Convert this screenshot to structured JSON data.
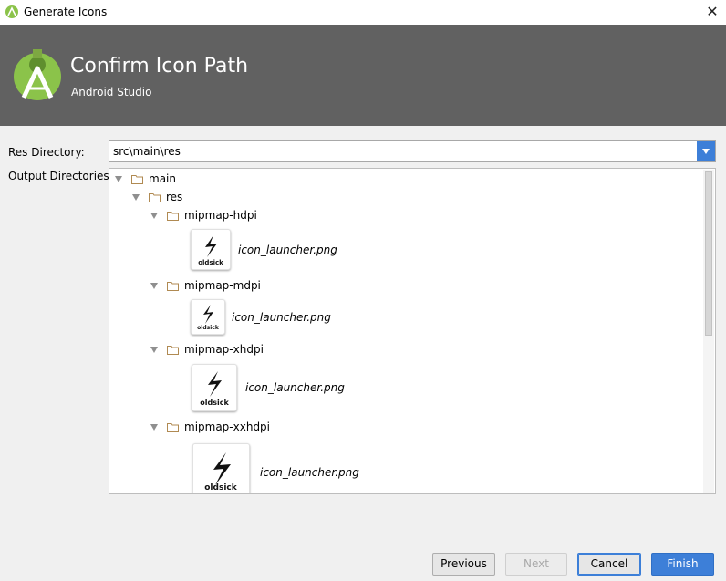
{
  "window": {
    "title": "Generate Icons"
  },
  "banner": {
    "heading": "Confirm Icon Path",
    "subtitle": "Android Studio"
  },
  "form": {
    "res_label": "Res Directory:",
    "res_value": "src\\main\\res",
    "output_label": "Output Directories:"
  },
  "tree": {
    "main": "main",
    "res": "res",
    "folders": [
      {
        "name": "mipmap-hdpi",
        "file": "icon_launcher.png"
      },
      {
        "name": "mipmap-mdpi",
        "file": "icon_launcher.png"
      },
      {
        "name": "mipmap-xhdpi",
        "file": "icon_launcher.png"
      },
      {
        "name": "mipmap-xxhdpi",
        "file": "icon_launcher.png"
      }
    ],
    "icon_text": "oldsick"
  },
  "buttons": {
    "previous": "Previous",
    "next": "Next",
    "cancel": "Cancel",
    "finish": "Finish"
  },
  "colors": {
    "banner": "#616161",
    "accent": "#3d7fd8",
    "android_green": "#8bc34a",
    "folder": "#b08a52"
  }
}
